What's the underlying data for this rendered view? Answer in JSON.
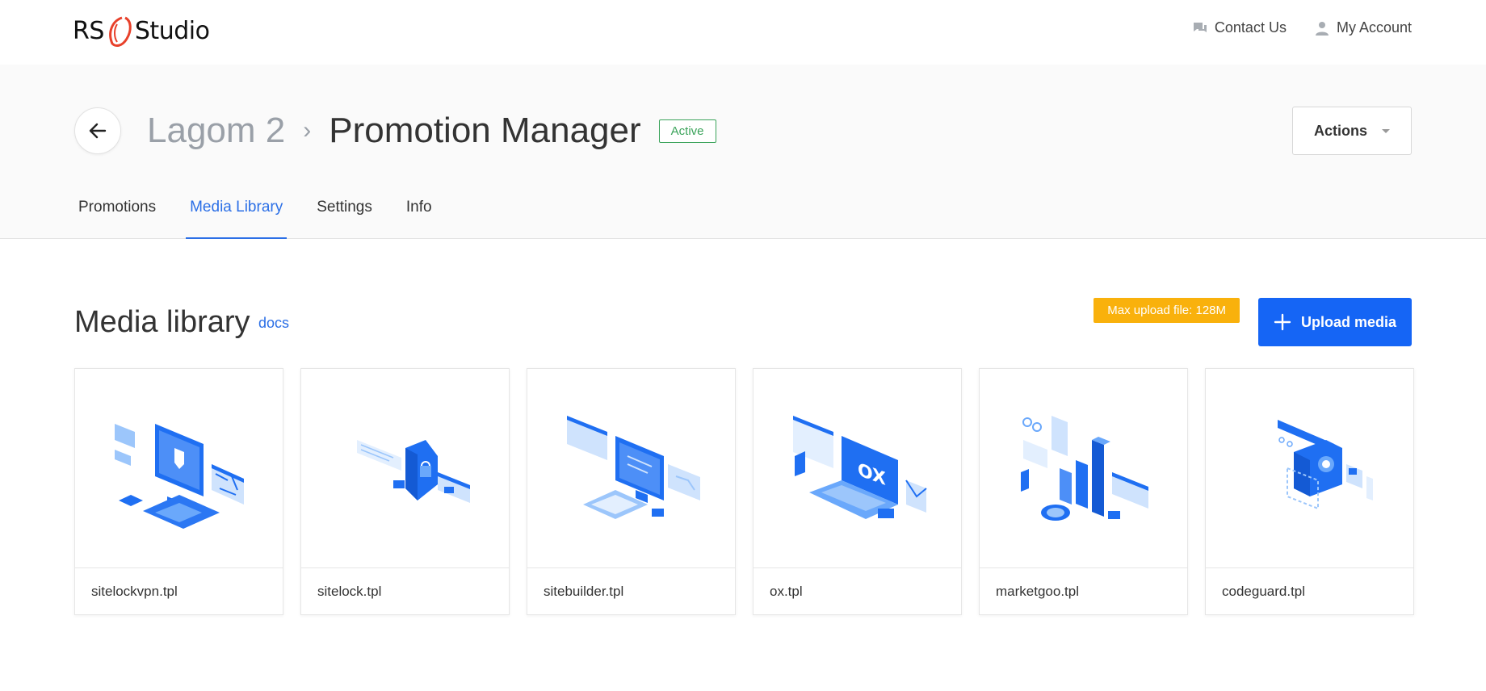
{
  "brand": {
    "logo_left": "RS",
    "logo_right": "Studio",
    "accent": "#e8402a"
  },
  "top_nav": {
    "contact_label": "Contact Us",
    "account_label": "My Account"
  },
  "header": {
    "breadcrumb_parent": "Lagom 2",
    "breadcrumb_separator": "›",
    "page_title": "Promotion Manager",
    "status": "Active",
    "actions_label": "Actions"
  },
  "tabs": [
    {
      "label": "Promotions",
      "active": false
    },
    {
      "label": "Media Library",
      "active": true
    },
    {
      "label": "Settings",
      "active": false
    },
    {
      "label": "Info",
      "active": false
    }
  ],
  "section": {
    "title": "Media library",
    "docs_label": "docs",
    "upload_limit": "Max upload file: 128M",
    "upload_label": "Upload media"
  },
  "media": [
    {
      "name": "sitelockvpn.tpl",
      "icon": "vpn-illustration-icon"
    },
    {
      "name": "sitelock.tpl",
      "icon": "shield-lock-illustration-icon"
    },
    {
      "name": "sitebuilder.tpl",
      "icon": "website-builder-illustration-icon"
    },
    {
      "name": "ox.tpl",
      "icon": "laptop-ox-illustration-icon"
    },
    {
      "name": "marketgoo.tpl",
      "icon": "seo-chart-illustration-icon"
    },
    {
      "name": "codeguard.tpl",
      "icon": "backup-safe-illustration-icon"
    }
  ],
  "colors": {
    "primary": "#1565f5",
    "link": "#2b6fe6",
    "success": "#3aa35a",
    "warning": "#f9b10c"
  }
}
